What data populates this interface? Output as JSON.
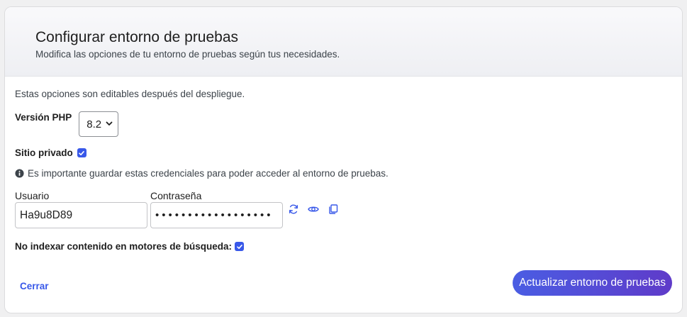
{
  "header": {
    "title": "Configurar entorno de pruebas",
    "subtitle": "Modifica las opciones de tu entorno de pruebas según tus necesidades."
  },
  "body": {
    "intro": "Estas opciones son editables después del despliegue.",
    "php": {
      "label": "Versión PHP",
      "selected": "8.2"
    },
    "private": {
      "label": "Sitio privado",
      "checked": true
    },
    "notice": "Es importante guardar estas credenciales para poder acceder al entorno de pruebas.",
    "username": {
      "label": "Usuario",
      "value": "Ha9u8D89"
    },
    "password": {
      "label": "Contraseña",
      "masked": "••••••••••••••••••"
    },
    "noindex": {
      "label": "No indexar contenido en motores de búsqueda:",
      "checked": true
    }
  },
  "footer": {
    "close_label": "Cerrar",
    "submit_label": "Actualizar entorno de pruebas"
  },
  "colors": {
    "accent": "#3858e9",
    "button_gradient_start": "#4a5de3",
    "button_gradient_end": "#5f3bc9"
  },
  "icons": [
    "chevron-down-icon",
    "check-icon",
    "info-icon",
    "refresh-icon",
    "eye-icon",
    "copy-icon"
  ]
}
